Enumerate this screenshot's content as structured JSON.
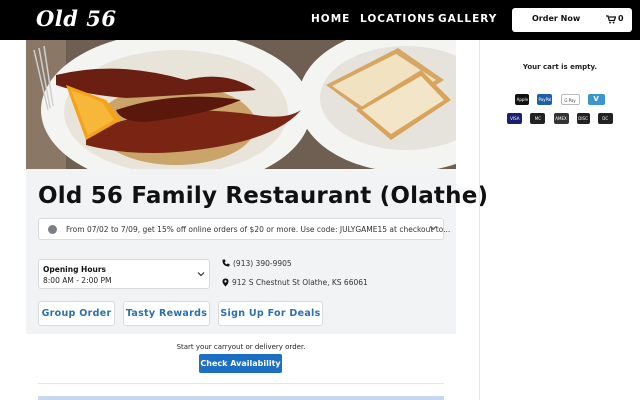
{
  "brand": {
    "logo_text": "Old 56"
  },
  "nav": {
    "items": [
      "HOME",
      "LOCATIONS",
      "GALLERY"
    ]
  },
  "order": {
    "label": "Order Now",
    "cart_count": "0"
  },
  "restaurant": {
    "name": "Old 56 Family Restaurant (Olathe)",
    "promo": "From 07/02 to 7/09, get 15% off online orders of $20 or more. Use code: JULYGAME15 at checkout to...",
    "hours_title": "Opening Hours",
    "hours_value": "8:00 AM - 2:00 PM",
    "phone": "(913) 390-9905",
    "address": "912 S Chestnut St Olathe, KS 66061"
  },
  "actions": {
    "group_order": "Group Order",
    "rewards": "Tasty Rewards",
    "deals": "Sign Up For Deals"
  },
  "availability": {
    "prompt": "Start your carryout or delivery order.",
    "button": "Check Availability"
  },
  "cart": {
    "empty_text": "Your cart is empty."
  },
  "payments": {
    "row1": [
      {
        "name": "apple-pay",
        "label": "Apple Pay"
      },
      {
        "name": "paypal",
        "label": "PayPal"
      },
      {
        "name": "google-pay",
        "label": "G Pay"
      },
      {
        "name": "venmo",
        "label": "V"
      }
    ],
    "row2": [
      {
        "name": "visa",
        "label": "VISA"
      },
      {
        "name": "mastercard",
        "label": "MC"
      },
      {
        "name": "amex",
        "label": "AMEX"
      },
      {
        "name": "discover",
        "label": "DISC"
      },
      {
        "name": "diners-club",
        "label": "DC"
      }
    ]
  },
  "colors": {
    "topbar": "#000000",
    "accent_blue": "#1d6fc2",
    "link_blue": "#2a6fb0",
    "panel_bg": "#f2f3f4"
  }
}
